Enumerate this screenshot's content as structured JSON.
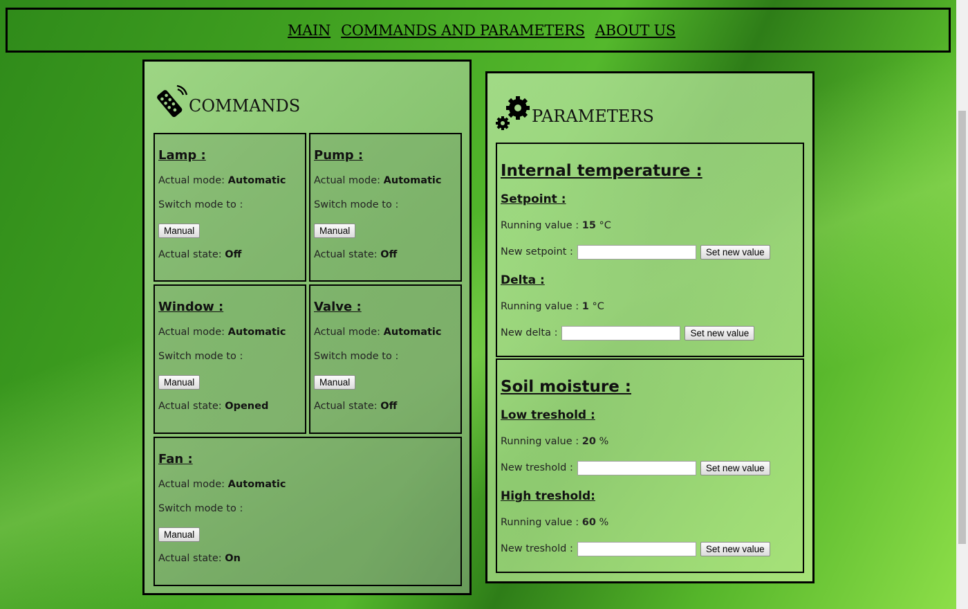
{
  "nav": {
    "items": [
      "MAIN",
      "COMMANDS AND PARAMETERS",
      "ABOUT US"
    ]
  },
  "commands": {
    "title": "COMMANDS",
    "mode_label": "Actual mode:",
    "switch_label": "Switch mode to :",
    "state_label": "Actual state:",
    "devices": [
      {
        "name": "Lamp :",
        "mode": "Automatic",
        "button": "Manual",
        "state": "Off"
      },
      {
        "name": "Pump :",
        "mode": "Automatic",
        "button": "Manual",
        "state": "Off"
      },
      {
        "name": "Window :",
        "mode": "Automatic",
        "button": "Manual",
        "state": "Opened"
      },
      {
        "name": "Valve :",
        "mode": "Automatic",
        "button": "Manual",
        "state": "Off"
      },
      {
        "name": "Fan :",
        "mode": "Automatic",
        "button": "Manual",
        "state": "On"
      }
    ]
  },
  "parameters": {
    "title": "PARAMETERS",
    "running_label": "Running value :",
    "set_button": "Set new value",
    "temperature": {
      "title": "Internal temperature :",
      "setpoint": {
        "title": "Setpoint :",
        "value": "15",
        "unit": "°C",
        "input_label": "New setpoint :",
        "input_value": ""
      },
      "delta": {
        "title": "Delta :",
        "value": "1",
        "unit": "°C",
        "input_label": "New delta :",
        "input_value": ""
      }
    },
    "moisture": {
      "title": "Soil moisture :",
      "low": {
        "title": "Low treshold :",
        "value": "20",
        "unit": "%",
        "input_label": "New treshold :",
        "input_value": ""
      },
      "high": {
        "title": "High treshold:",
        "value": "60",
        "unit": "%",
        "input_label": "New treshold :",
        "input_value": ""
      }
    }
  },
  "icons": {
    "commands": "remote-control-icon",
    "parameters": "gears-icon"
  }
}
